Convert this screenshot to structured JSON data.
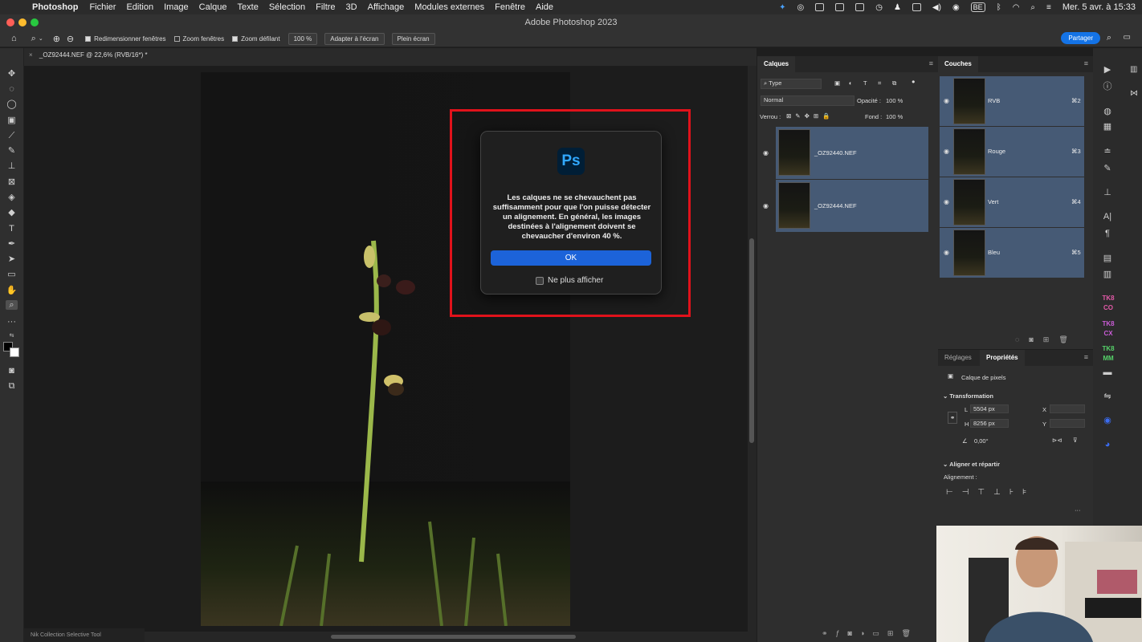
{
  "menubar": {
    "app": "Photoshop",
    "menus": [
      "Fichier",
      "Edition",
      "Image",
      "Calque",
      "Texte",
      "Sélection",
      "Filtre",
      "3D",
      "Affichage",
      "Modules externes",
      "Fenêtre",
      "Aide"
    ],
    "keyboard": "BE",
    "clock": "Mer. 5 avr. à 15:33"
  },
  "window": {
    "title": "Adobe Photoshop 2023"
  },
  "options": {
    "resize_windows": "Redimensionner fenêtres",
    "zoom_windows": "Zoom fenêtres",
    "scrubby_zoom": "Zoom défilant",
    "zoom_value": "100 %",
    "fit_screen": "Adapter à l'écran",
    "full_screen": "Plein écran",
    "share": "Partager"
  },
  "document": {
    "tab": "_OZ92444.NEF @ 22,6% (RVB/16*) *"
  },
  "dialog": {
    "logo": "Ps",
    "message": "Les calques ne se chevauchent pas suffisamment pour que l'on puisse détecter un alignement. En général, les images destinées à l'alignement doivent se chevaucher d'environ 40 %.",
    "ok": "OK",
    "dont_show": "Ne plus afficher"
  },
  "layers_panel": {
    "tab": "Calques",
    "filter": "Type",
    "blend": "Normal",
    "opacity_label": "Opacité :",
    "opacity": "100 %",
    "lock_label": "Verrou :",
    "fill_label": "Fond :",
    "fill": "100 %",
    "layers": [
      {
        "name": "_OZ92440.NEF"
      },
      {
        "name": "_OZ92444.NEF"
      }
    ]
  },
  "channels_panel": {
    "tab": "Couches",
    "channels": [
      {
        "name": "RVB",
        "shortcut": "⌘2"
      },
      {
        "name": "Rouge",
        "shortcut": "⌘3"
      },
      {
        "name": "Vert",
        "shortcut": "⌘4"
      },
      {
        "name": "Bleu",
        "shortcut": "⌘5"
      }
    ]
  },
  "properties_panel": {
    "tabs": [
      "Réglages",
      "Propriétés"
    ],
    "type": "Calque de pixels",
    "transform_title": "Transformation",
    "w_label": "L",
    "w": "5504 px",
    "h_label": "H",
    "h": "8256 px",
    "x_label": "X",
    "y_label": "Y",
    "angle": "0,00°",
    "align_title": "Aligner et répartir",
    "align_label": "Alignement :"
  },
  "status": {
    "text": "Nik Collection Selective Tool"
  },
  "dock": {
    "tk_labels": [
      "TK8 CO",
      "TK8 CX",
      "TK8 MM"
    ]
  },
  "colors": {
    "accent": "#1473e6",
    "highlight_box": "#e0121b",
    "layer_selected": "#465a75"
  }
}
